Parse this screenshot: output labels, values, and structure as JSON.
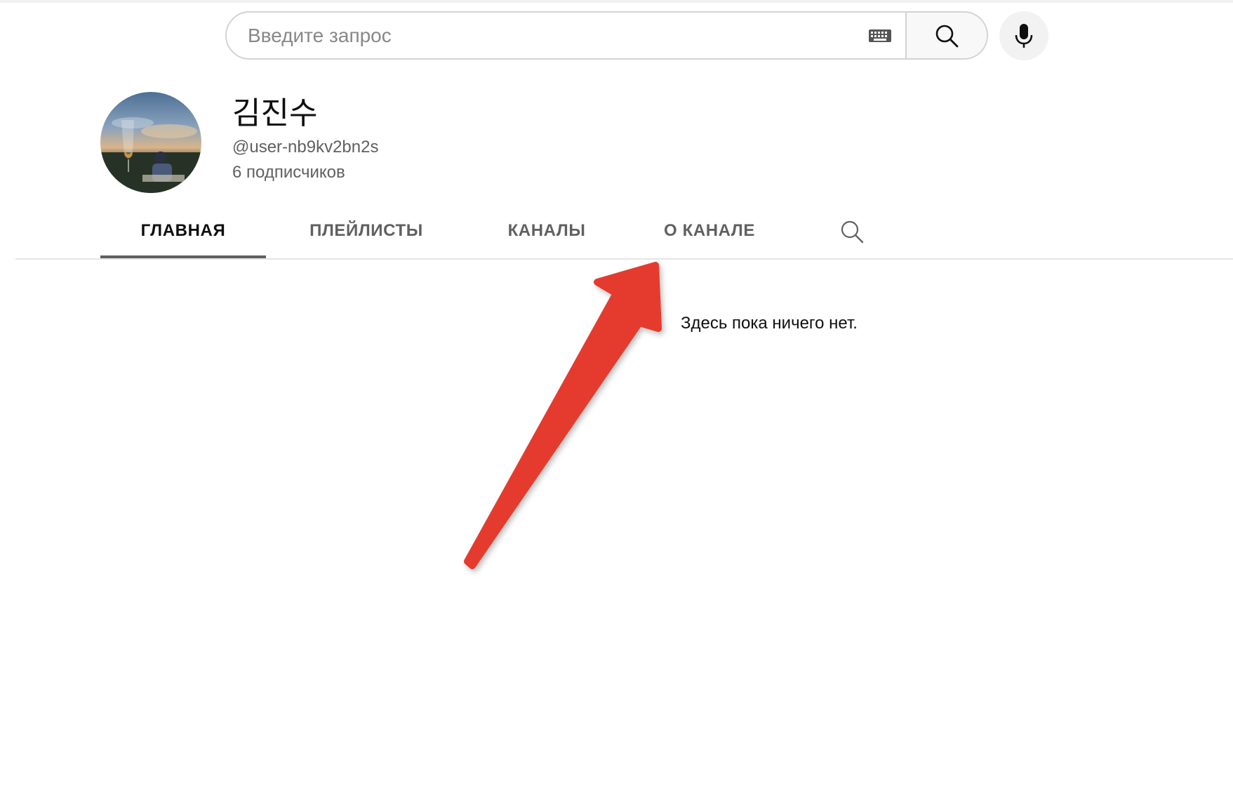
{
  "search": {
    "placeholder": "Введите запрос",
    "value": ""
  },
  "icons": {
    "keyboard": "keyboard-icon",
    "search": "search-icon",
    "mic": "microphone-icon",
    "tab_search": "search-icon"
  },
  "channel": {
    "name": "김진수",
    "handle": "@user-nb9kv2bn2s",
    "subscribers": "6 подписчиков"
  },
  "tabs": [
    {
      "label": "ГЛАВНАЯ",
      "active": true
    },
    {
      "label": "ПЛЕЙЛИСТЫ",
      "active": false
    },
    {
      "label": "КАНАЛЫ",
      "active": false
    },
    {
      "label": "О КАНАЛЕ",
      "active": false
    }
  ],
  "content": {
    "empty_message": "Здесь пока ничего нет."
  },
  "colors": {
    "annotation_arrow": "#e53a2e",
    "text_primary": "#0f0f0f",
    "text_secondary": "#606060"
  }
}
